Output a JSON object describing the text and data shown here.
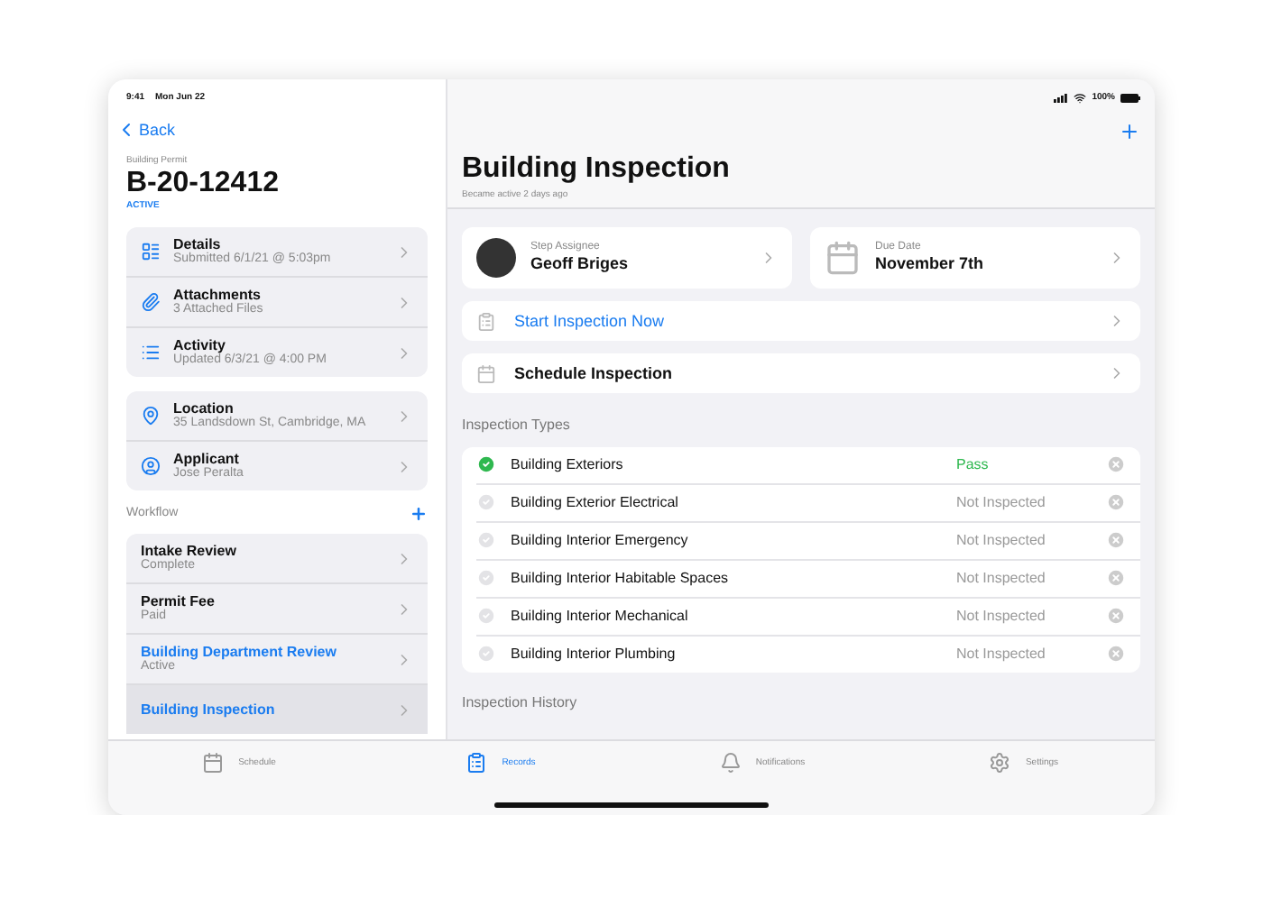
{
  "status_bar": {
    "time": "9:41",
    "date": "Mon Jun 22",
    "battery": "100%"
  },
  "sidebar": {
    "back": "Back",
    "record_type": "Building Permit",
    "record_number": "B-20-12412",
    "record_status": "ACTIVE",
    "info_groups": [
      [
        {
          "kind": "details",
          "title": "Details",
          "subtitle": "Submitted 6/1/21 @ 5:03pm"
        },
        {
          "kind": "attachments",
          "title": "Attachments",
          "subtitle": "3 Attached Files"
        },
        {
          "kind": "activity",
          "title": "Activity",
          "subtitle": "Updated 6/3/21 @ 4:00 PM"
        }
      ],
      [
        {
          "kind": "location",
          "title": "Location",
          "subtitle": "35 Landsdown St, Cambridge, MA"
        },
        {
          "kind": "applicant",
          "title": "Applicant",
          "subtitle": "Jose Peralta"
        }
      ]
    ],
    "workflow_title": "Workflow",
    "workflow": [
      {
        "title": "Intake Review",
        "subtitle": "Complete",
        "active": false,
        "selected": false
      },
      {
        "title": "Permit Fee",
        "subtitle": "Paid",
        "active": false,
        "selected": false
      },
      {
        "title": "Building Department Review",
        "subtitle": "Active",
        "active": true,
        "selected": false
      },
      {
        "title": "Building Inspection",
        "active": true,
        "selected": true
      }
    ]
  },
  "detail": {
    "title": "Building Inspection",
    "subtitle": "Became active 2 days ago",
    "assignee": {
      "label": "Step Assignee",
      "value": "Geoff Briges"
    },
    "due_date": {
      "label": "Due Date",
      "value": "November 7th"
    },
    "actions": [
      {
        "kind": "start",
        "label": "Start Inspection Now"
      },
      {
        "kind": "schedule",
        "label": "Schedule Inspection"
      }
    ],
    "inspection_types_title": "Inspection Types",
    "inspection_types": [
      {
        "name": "Building Exteriors",
        "status": "Pass",
        "kind": "pass"
      },
      {
        "name": "Building Exterior Electrical",
        "status": "Not Inspected",
        "kind": "not_inspected"
      },
      {
        "name": "Building Interior Emergency",
        "status": "Not Inspected",
        "kind": "not_inspected"
      },
      {
        "name": "Building Interior Habitable Spaces",
        "status": "Not Inspected",
        "kind": "not_inspected"
      },
      {
        "name": "Building Interior Mechanical",
        "status": "Not Inspected",
        "kind": "not_inspected"
      },
      {
        "name": "Building Interior Plumbing",
        "status": "Not Inspected",
        "kind": "not_inspected"
      }
    ],
    "inspection_history_title": "Inspection History"
  },
  "tab_bar": [
    {
      "kind": "schedule",
      "label": "Schedule",
      "selected": false
    },
    {
      "kind": "records",
      "label": "Records",
      "selected": true
    },
    {
      "kind": "notifications",
      "label": "Notifications",
      "selected": false
    },
    {
      "kind": "settings",
      "label": "Settings",
      "selected": false
    }
  ]
}
